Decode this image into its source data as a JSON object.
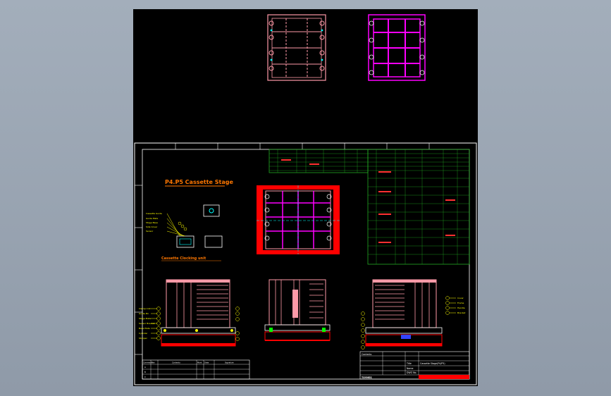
{
  "drawing": {
    "view_title": "P4.P5 Cassette Stage",
    "sub_title": "Cassette Clocking unit",
    "colors": {
      "background_outer": "#9ba7b5",
      "sheet": "#000000",
      "frame": "#ffffff",
      "part_pink": "#ff9aa8",
      "part_magenta": "#ff00ff",
      "table_green": "#22aa22",
      "callout_yellow": "#ffff00",
      "accent_red": "#ff0000",
      "title_orange": "#ff7700",
      "cyan": "#00ffff"
    }
  },
  "title_block": {
    "company": "TOYMES",
    "rev_header": "Contents",
    "fields": [
      "Title",
      "Name",
      "Cassette Stage(P4/P5)",
      "DWG No."
    ]
  },
  "revision_table": {
    "headers": [
      "Comment",
      "Rev",
      "Contents",
      "Mark",
      "Date",
      "Signature"
    ],
    "rows": [
      [
        "A",
        "",
        "",
        "",
        "",
        ""
      ],
      [
        "B",
        "",
        "",
        "",
        "",
        ""
      ],
      [
        "C",
        "",
        "",
        "",
        "",
        ""
      ]
    ]
  },
  "callouts": {
    "left_upper": [
      "Cassette Guide",
      "Guide Plate",
      "Stage Base",
      "Side Cover",
      "Sensor"
    ],
    "left_bottom": [
      "Clamp Unit",
      "Guide Pin",
      "Stage Plate",
      "Sensor Bracket",
      "Base Plate",
      "Cylinder",
      "Stopper"
    ],
    "right_bottom": [
      "Cover",
      "Frame",
      "Handle",
      "Bracket"
    ]
  }
}
